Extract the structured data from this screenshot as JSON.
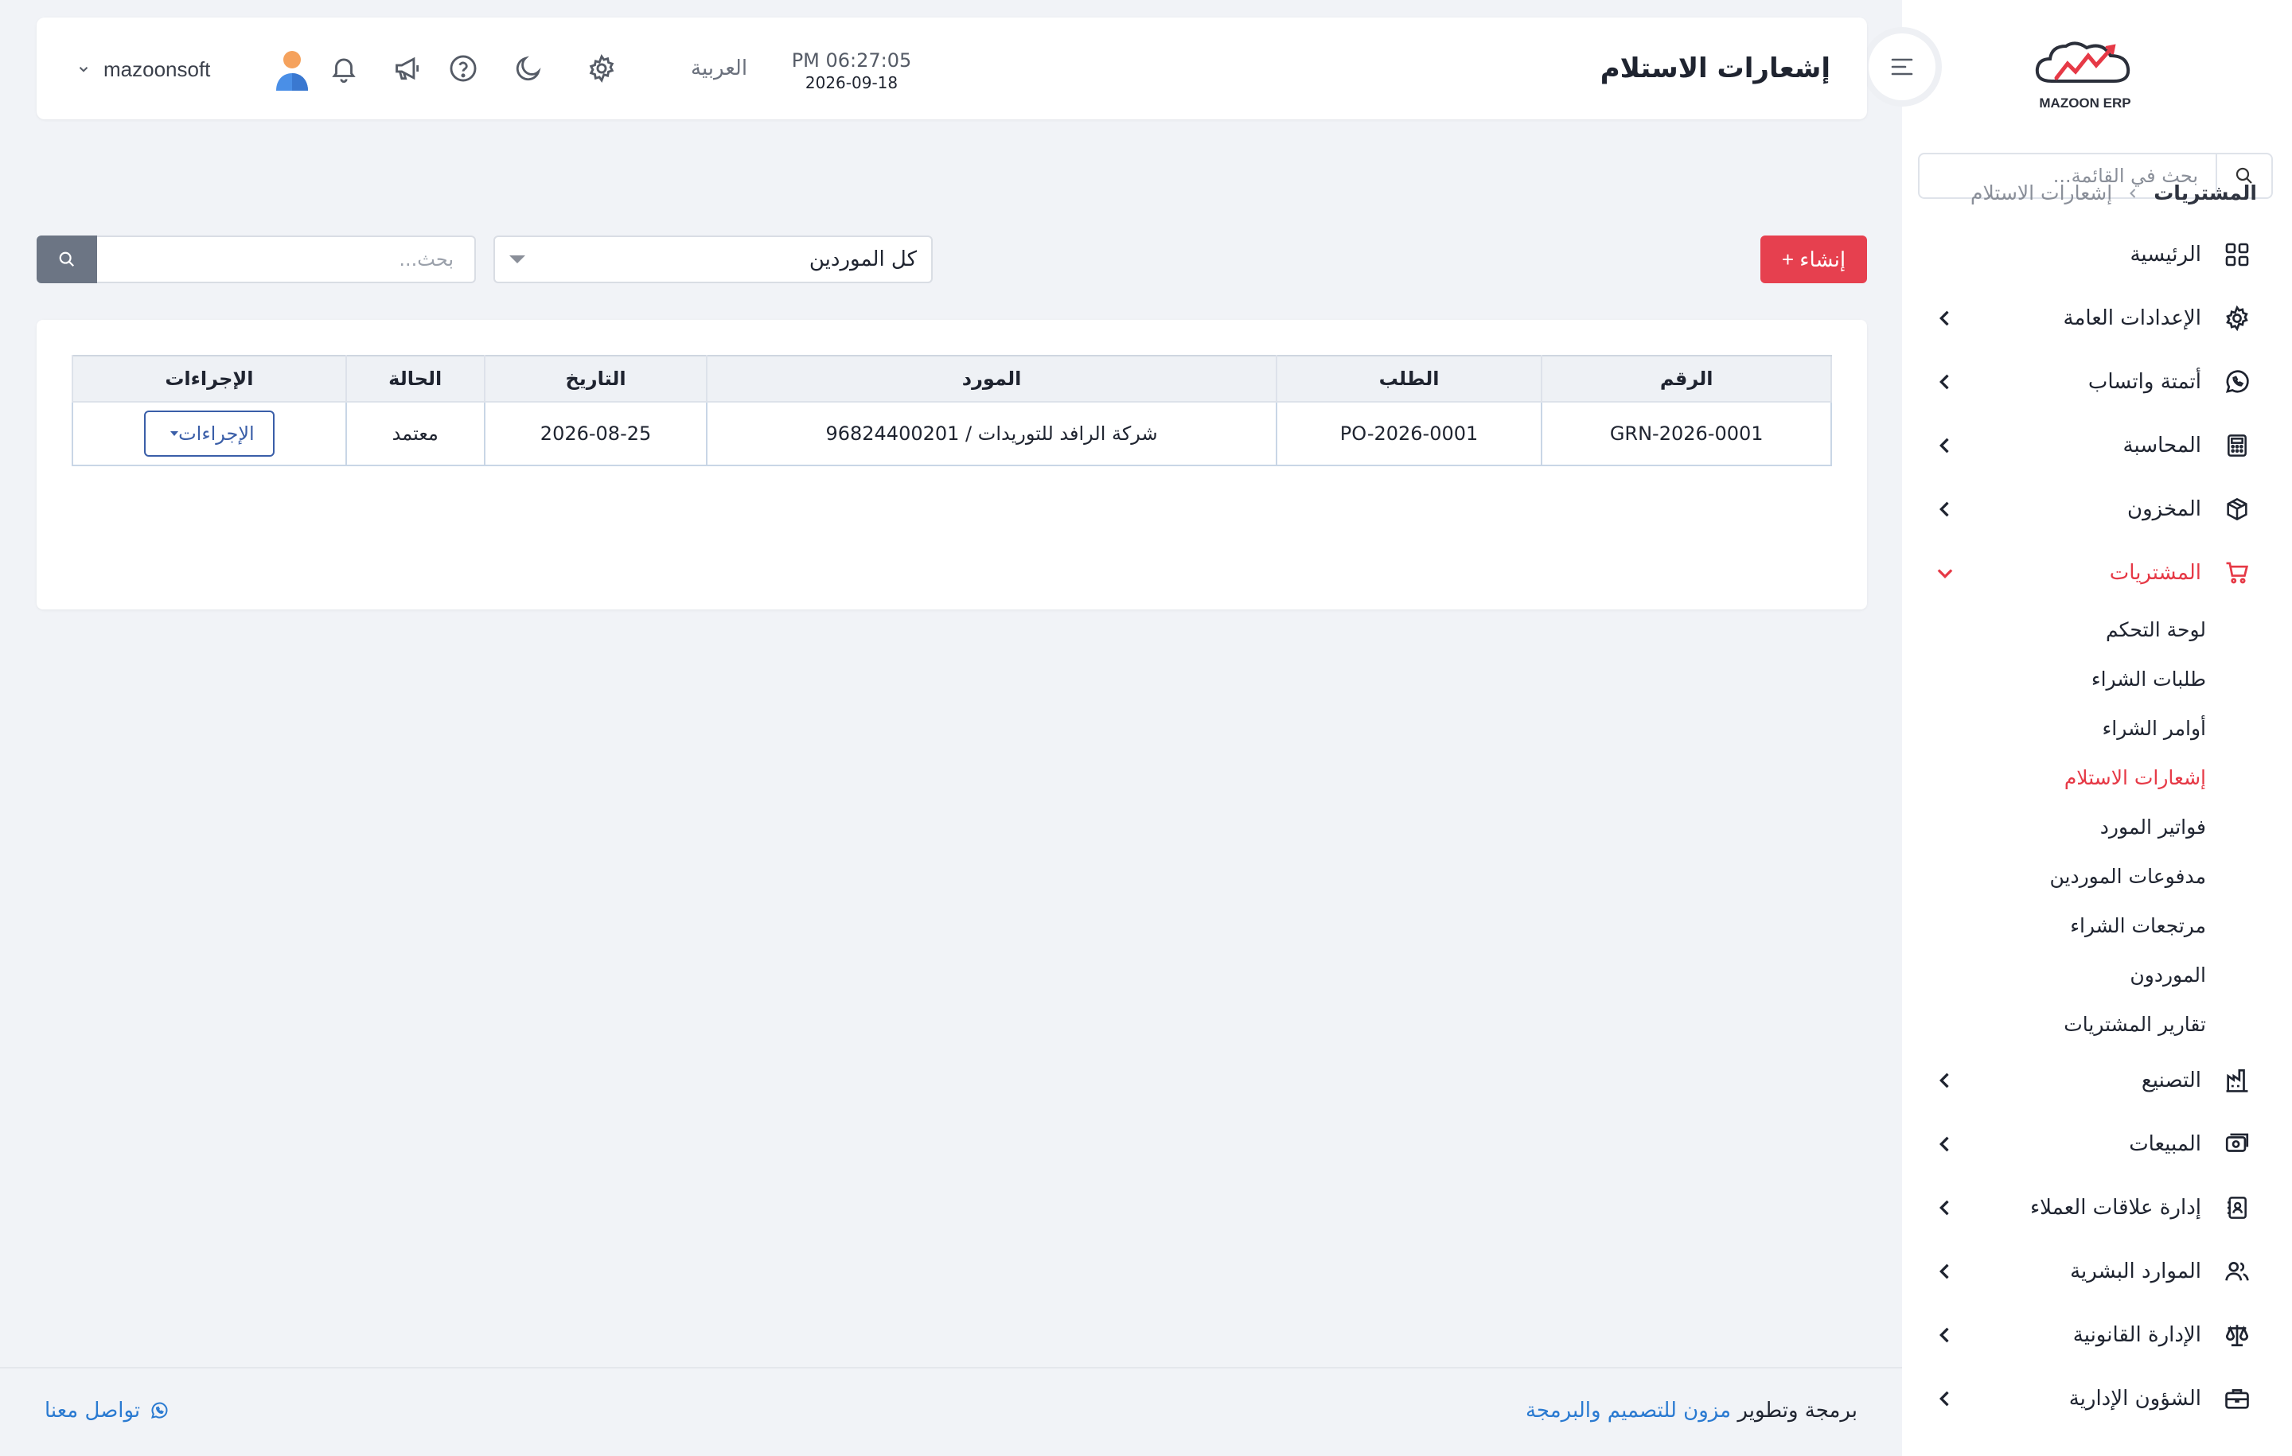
{
  "brand": {
    "logo_text": "MAZOON ERP"
  },
  "sidebar": {
    "search_placeholder": "بحث في القائمة...",
    "items": [
      {
        "label": "الرئيسية",
        "icon": "grid-icon"
      },
      {
        "label": "الإعدادات العامة",
        "icon": "gear-icon"
      },
      {
        "label": "أتمتة واتساب",
        "icon": "whatsapp-icon"
      },
      {
        "label": "المحاسبة",
        "icon": "calculator-icon"
      },
      {
        "label": "المخزون",
        "icon": "box-icon"
      },
      {
        "label": "المشتريات",
        "icon": "cart-icon"
      },
      {
        "label": "التصنيع",
        "icon": "factory-icon"
      },
      {
        "label": "المبيعات",
        "icon": "cash-register-icon"
      },
      {
        "label": "إدارة علاقات العملاء",
        "icon": "contacts-icon"
      },
      {
        "label": "الموارد البشرية",
        "icon": "users-icon"
      },
      {
        "label": "الإدارة القانونية",
        "icon": "scale-icon"
      },
      {
        "label": "الشؤون الإدارية",
        "icon": "briefcase-icon"
      }
    ],
    "purchases_sub": [
      "لوحة التحكم",
      "طلبات الشراء",
      "أوامر الشراء",
      "إشعارات الاستلام",
      "فواتير المورد",
      "مدفوعات الموردين",
      "مرتجعات الشراء",
      "الموردون",
      "تقارير المشتريات"
    ]
  },
  "header": {
    "title": "إشعارات الاستلام",
    "time": "PM 06:27:05",
    "date": "2026-09-18",
    "language": "العربية",
    "username": "mazoonsoft"
  },
  "breadcrumb": {
    "parent": "المشتريات",
    "current": "إشعارات الاستلام"
  },
  "toolbar": {
    "create_label": "+ إنشاء",
    "supplier_filter": "كل الموردين",
    "search_placeholder": "بحث..."
  },
  "table": {
    "headers": [
      "الرقم",
      "الطلب",
      "المورد",
      "التاريخ",
      "الحالة",
      "الإجراءات"
    ],
    "rows": [
      {
        "number": "GRN-2026-0001",
        "order": "PO-2026-0001",
        "supplier": "شركة الرافد للتوريدات / 96824400201",
        "date": "2026-08-25",
        "status": "معتمد",
        "actions_label": "الإجراءات"
      }
    ]
  },
  "footer": {
    "credit_prefix": "برمجة وتطوير",
    "credit_link": "مزون للتصميم والبرمجة",
    "contact": "تواصل معنا"
  },
  "colors": {
    "accent": "#e6404f",
    "link": "#2a7ad1",
    "action_blue": "#3a5ea8"
  }
}
